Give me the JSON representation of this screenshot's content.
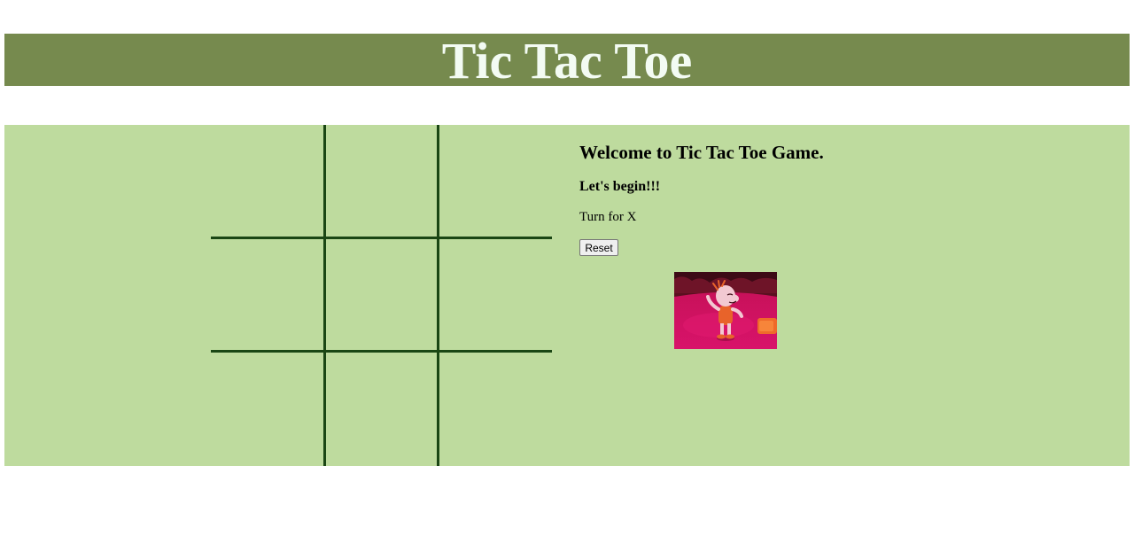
{
  "header": {
    "title": "Tic Tac Toe"
  },
  "board": {
    "cells": [
      "",
      "",
      "",
      "",
      "",
      "",
      "",
      "",
      ""
    ]
  },
  "info": {
    "welcome": "Welcome to Tic Tac Toe Game.",
    "subtitle": "Let's begin!!!",
    "turn": "Turn for X",
    "reset_label": "Reset"
  },
  "colors": {
    "header_bg": "#768a4e",
    "header_text": "#f3fbf3",
    "game_bg": "#bedb9e",
    "grid_line": "#1a4614"
  },
  "image": {
    "description_icon": "dancing-cartoon-gif"
  }
}
